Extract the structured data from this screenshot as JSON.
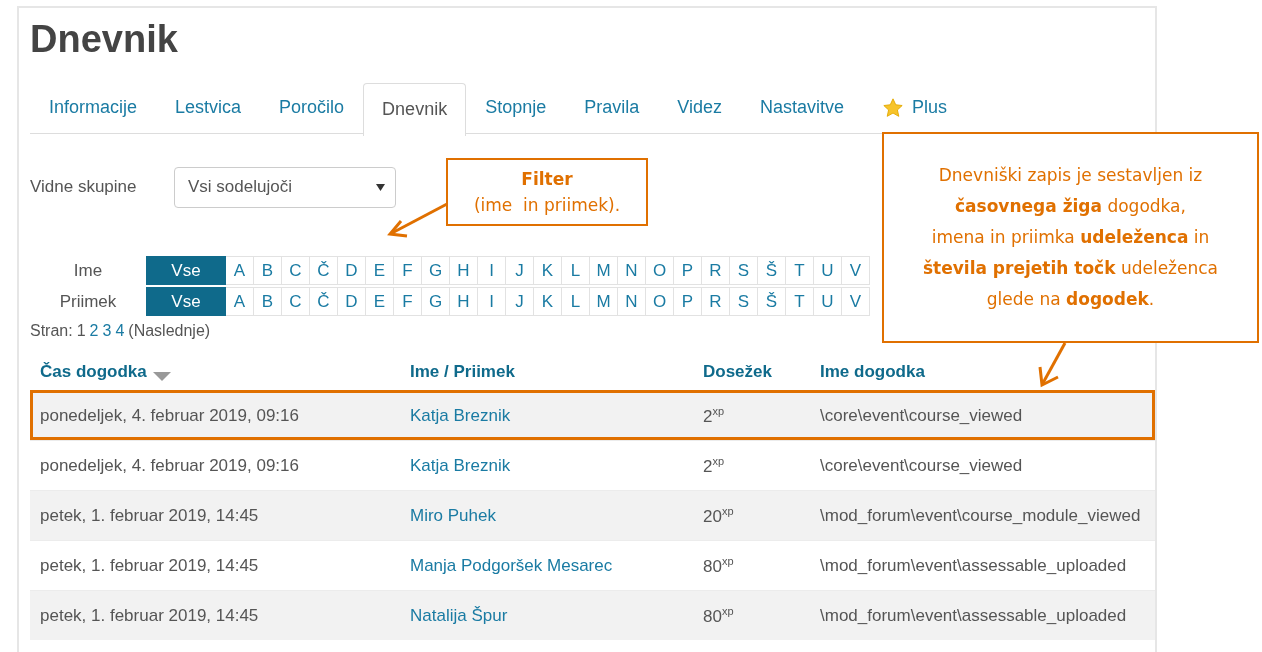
{
  "title": "Dnevnik",
  "tabs": [
    {
      "label": "Informacije",
      "selected": false,
      "kind": "plain"
    },
    {
      "label": "Lestvica",
      "selected": false,
      "kind": "plain"
    },
    {
      "label": "Poročilo",
      "selected": false,
      "kind": "plain"
    },
    {
      "label": "Dnevnik",
      "selected": true,
      "kind": "plain"
    },
    {
      "label": "Stopnje",
      "selected": false,
      "kind": "plain"
    },
    {
      "label": "Pravila",
      "selected": false,
      "kind": "plain"
    },
    {
      "label": "Videz",
      "selected": false,
      "kind": "plain"
    },
    {
      "label": "Nastavitve",
      "selected": false,
      "kind": "plain"
    },
    {
      "label": "Plus",
      "selected": false,
      "kind": "starred"
    }
  ],
  "group_filter": {
    "label": "Vidne skupine",
    "value": "Vsi sodelujoči"
  },
  "letter_filters": [
    {
      "label": "Ime",
      "letters": [
        {
          "label": "Vse",
          "selected": true
        },
        {
          "label": "A",
          "selected": false
        },
        {
          "label": "B",
          "selected": false
        },
        {
          "label": "C",
          "selected": false
        },
        {
          "label": "Č",
          "selected": false
        },
        {
          "label": "D",
          "selected": false
        },
        {
          "label": "E",
          "selected": false
        },
        {
          "label": "F",
          "selected": false
        },
        {
          "label": "G",
          "selected": false
        },
        {
          "label": "H",
          "selected": false
        },
        {
          "label": "I",
          "selected": false
        },
        {
          "label": "J",
          "selected": false
        },
        {
          "label": "K",
          "selected": false
        },
        {
          "label": "L",
          "selected": false
        },
        {
          "label": "M",
          "selected": false
        },
        {
          "label": "N",
          "selected": false
        },
        {
          "label": "O",
          "selected": false
        },
        {
          "label": "P",
          "selected": false
        },
        {
          "label": "R",
          "selected": false
        },
        {
          "label": "S",
          "selected": false
        },
        {
          "label": "Š",
          "selected": false
        },
        {
          "label": "T",
          "selected": false
        },
        {
          "label": "U",
          "selected": false
        },
        {
          "label": "V",
          "selected": false
        }
      ]
    },
    {
      "label": "Priimek",
      "letters": [
        {
          "label": "Vse",
          "selected": true
        },
        {
          "label": "A",
          "selected": false
        },
        {
          "label": "B",
          "selected": false
        },
        {
          "label": "C",
          "selected": false
        },
        {
          "label": "Č",
          "selected": false
        },
        {
          "label": "D",
          "selected": false
        },
        {
          "label": "E",
          "selected": false
        },
        {
          "label": "F",
          "selected": false
        },
        {
          "label": "G",
          "selected": false
        },
        {
          "label": "H",
          "selected": false
        },
        {
          "label": "I",
          "selected": false
        },
        {
          "label": "J",
          "selected": false
        },
        {
          "label": "K",
          "selected": false
        },
        {
          "label": "L",
          "selected": false
        },
        {
          "label": "M",
          "selected": false
        },
        {
          "label": "N",
          "selected": false
        },
        {
          "label": "O",
          "selected": false
        },
        {
          "label": "P",
          "selected": false
        },
        {
          "label": "R",
          "selected": false
        },
        {
          "label": "S",
          "selected": false
        },
        {
          "label": "Š",
          "selected": false
        },
        {
          "label": "T",
          "selected": false
        },
        {
          "label": "U",
          "selected": false
        },
        {
          "label": "V",
          "selected": false
        }
      ]
    }
  ],
  "pagination": {
    "label": "Stran:",
    "pages": [
      {
        "label": "1",
        "selected": true
      },
      {
        "label": "2",
        "selected": false
      },
      {
        "label": "3",
        "selected": false
      },
      {
        "label": "4",
        "selected": false
      }
    ],
    "next": "(Naslednje)"
  },
  "table": {
    "columns": [
      {
        "label": "Čas dogodka",
        "sorted": true
      },
      {
        "label": "Ime / Priimek",
        "sorted": false
      },
      {
        "label": "Dosežek",
        "sorted": false
      },
      {
        "label": "Ime dogodka",
        "sorted": false
      }
    ],
    "rows": [
      {
        "time": "ponedeljek, 4. februar 2019, 09:16",
        "name": "Katja Breznik",
        "points": "2$^{xp}$",
        "event": "\\core\\event\\course_viewed",
        "highlighted": true
      },
      {
        "time": "ponedeljek, 4. februar 2019, 09:16",
        "name": "Katja Breznik",
        "points": "2$^{xp}$",
        "event": "\\core\\event\\course_viewed",
        "highlighted": false
      },
      {
        "time": "petek, 1. februar 2019, 14:45",
        "name": "Miro Puhek",
        "points": "20$^{xp}$",
        "event": "\\mod_forum\\event\\course_module_viewed",
        "highlighted": false
      },
      {
        "time": "petek, 1. februar 2019, 14:45",
        "name": "Manja Podgoršek Mesarec",
        "points": "80$^{xp}$",
        "event": "\\mod_forum\\event\\assessable_uploaded",
        "highlighted": false
      },
      {
        "time": "petek, 1. februar 2019, 14:45",
        "name": "Natalija Špur",
        "points": "80$^{xp}$",
        "event": "\\mod_forum\\event\\assessable_uploaded",
        "highlighted": false
      }
    ]
  },
  "annotations": [
    {
      "kind": "filter",
      "title": "Filter",
      "lines": [
        "(ime  in priimek)."
      ]
    },
    {
      "kind": "record",
      "lines": [
        "Dnevniški zapis je sestavljen iz",
        "**časovnega žiga** dogodka,",
        "imena in priimka **udeleženca** in",
        "**števila prejetih točk** udeleženca",
        "glede na **dogodek**."
      ]
    }
  ]
}
